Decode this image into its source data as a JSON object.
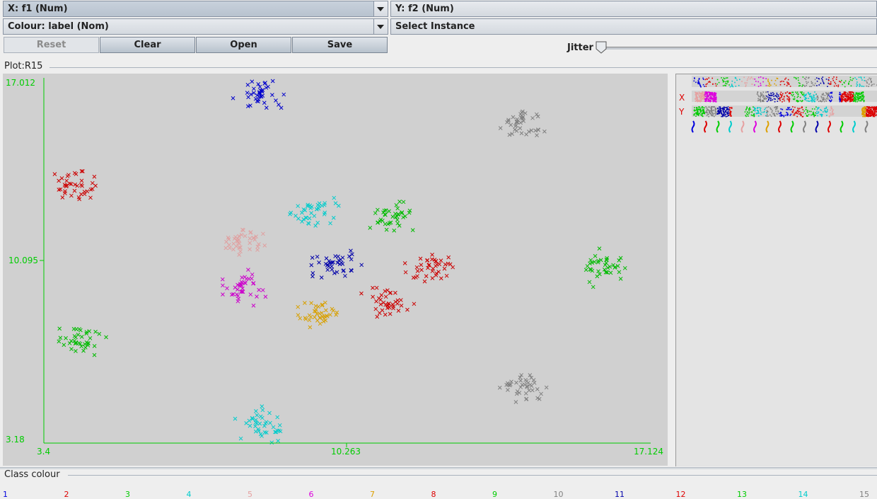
{
  "controls": {
    "x_axis": "X: f1 (Num)",
    "y_axis": "Y: f2 (Num)",
    "colour": "Colour: label (Nom)",
    "select_instance": "Select Instance",
    "reset": "Reset",
    "clear": "Clear",
    "open": "Open",
    "save": "Save",
    "jitter": "Jitter"
  },
  "plot": {
    "title": "Plot:R15",
    "x_ticks": [
      "3.4",
      "10.263",
      "17.124"
    ],
    "y_ticks": [
      "17.012",
      "10.095",
      "3.18"
    ],
    "axis_color": "#00cc00"
  },
  "side": {
    "x_mark": "X",
    "y_mark": "Y"
  },
  "legend": {
    "title": "Class colour",
    "classes": [
      {
        "label": "1",
        "color": "#0000dd"
      },
      {
        "label": "2",
        "color": "#dd0000"
      },
      {
        "label": "3",
        "color": "#00cc00"
      },
      {
        "label": "4",
        "color": "#00cccc"
      },
      {
        "label": "5",
        "color": "#e6a0a0"
      },
      {
        "label": "6",
        "color": "#dd00dd"
      },
      {
        "label": "7",
        "color": "#dda000"
      },
      {
        "label": "8",
        "color": "#dd0000"
      },
      {
        "label": "9",
        "color": "#00cc00"
      },
      {
        "label": "10",
        "color": "#808080"
      },
      {
        "label": "11",
        "color": "#0000aa"
      },
      {
        "label": "12",
        "color": "#dd0000"
      },
      {
        "label": "13",
        "color": "#00cc00"
      },
      {
        "label": "14",
        "color": "#00cccc"
      },
      {
        "label": "15",
        "color": "#808080"
      }
    ]
  },
  "chart_data": {
    "type": "scatter",
    "title": "",
    "xlabel": "f1",
    "ylabel": "f2",
    "xlim": [
      3.4,
      17.124
    ],
    "ylim": [
      3.18,
      17.012
    ],
    "clusters": [
      {
        "name": "1",
        "x": 8.4,
        "y": 16.4,
        "color": "#0000cc"
      },
      {
        "name": "2",
        "x": 4.2,
        "y": 12.9,
        "color": "#cc0000"
      },
      {
        "name": "3",
        "x": 4.2,
        "y": 7.1,
        "color": "#00bb00"
      },
      {
        "name": "4",
        "x": 8.4,
        "y": 3.8,
        "color": "#00cccc"
      },
      {
        "name": "5",
        "x": 8.0,
        "y": 10.9,
        "color": "#e0a0a0"
      },
      {
        "name": "6",
        "x": 7.9,
        "y": 9.0,
        "color": "#cc00cc"
      },
      {
        "name": "7",
        "x": 9.6,
        "y": 8.1,
        "color": "#d8a000"
      },
      {
        "name": "8",
        "x": 11.2,
        "y": 8.5,
        "color": "#cc0000"
      },
      {
        "name": "9",
        "x": 16.1,
        "y": 9.9,
        "color": "#00bb00"
      },
      {
        "name": "10",
        "x": 14.2,
        "y": 15.3,
        "color": "#808080"
      },
      {
        "name": "11",
        "x": 10.0,
        "y": 10.0,
        "color": "#0000aa"
      },
      {
        "name": "12",
        "x": 12.2,
        "y": 9.8,
        "color": "#cc0000"
      },
      {
        "name": "13",
        "x": 11.3,
        "y": 11.7,
        "color": "#00bb00"
      },
      {
        "name": "14",
        "x": 9.5,
        "y": 11.9,
        "color": "#00cccc"
      },
      {
        "name": "15",
        "x": 14.2,
        "y": 5.2,
        "color": "#808080"
      }
    ]
  }
}
